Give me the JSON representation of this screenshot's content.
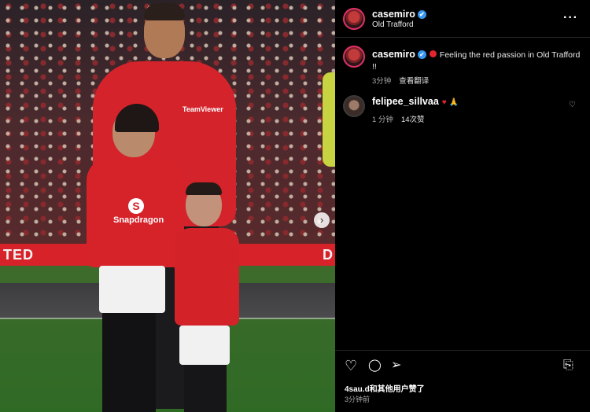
{
  "post": {
    "photo_board_left": "TED",
    "photo_board_right": "D",
    "sponsor_girl": "Snapdragon",
    "sponsor_adult": "TeamViewer",
    "next_arrow": "›"
  },
  "header": {
    "username": "casemiro",
    "verified_mark": "✔",
    "location": "Old Trafford",
    "more_label": "···"
  },
  "caption": {
    "username": "casemiro",
    "verified_mark": "✔",
    "text": "Feeling the red passion in Old Trafford !!",
    "time": "3分钟",
    "translate": "查看翻译"
  },
  "comment": {
    "username": "felipee_sillvaa",
    "emoji_heart": "♥",
    "emoji_pray": "🙏",
    "time": "1 分钟",
    "likes": "14次赞"
  },
  "actions": {
    "like_icon": "♡",
    "comment_icon": "◯",
    "share_icon": "➢",
    "save_icon": "⎘"
  },
  "footer": {
    "likes_text": "4sau.d和其他用户赞了",
    "time": "3分钟前"
  },
  "colors": {
    "background": "#000000",
    "verified_blue": "#3797f0",
    "accent_red": "#e3262e",
    "kit_red": "#d5232b"
  }
}
